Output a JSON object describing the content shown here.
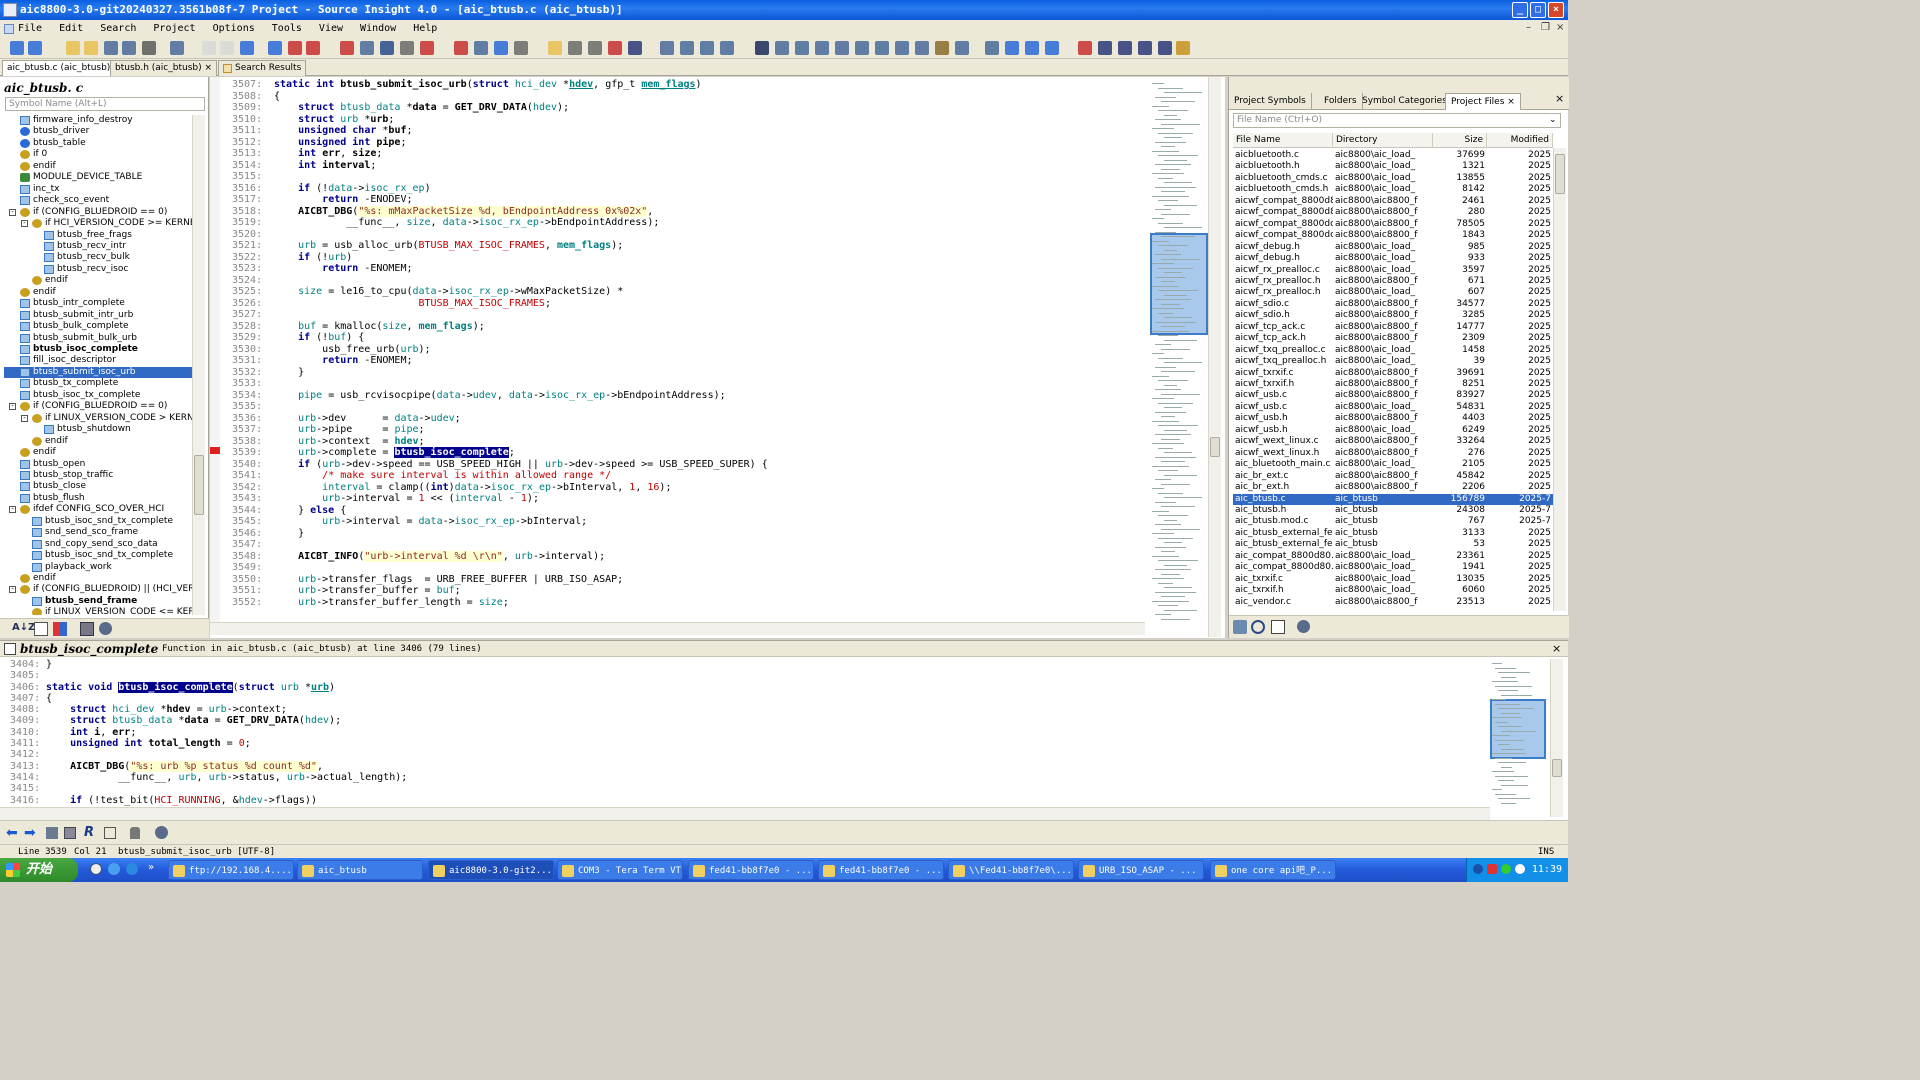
{
  "window": {
    "title": "aic8800-3.0-git20240327.3561b08f-7 Project - Source Insight 4.0 - [aic_btusb.c (aic_btusb)]"
  },
  "menu": [
    "File",
    "Edit",
    "Search",
    "Project",
    "Options",
    "Tools",
    "View",
    "Window",
    "Help"
  ],
  "tabs": [
    {
      "label": "aic_btusb.c (aic_btusb)",
      "close": "×"
    },
    {
      "label": "btusb.h (aic_btusb)",
      "close": "×"
    },
    {
      "label": "Search Results"
    }
  ],
  "symbol_panel": {
    "title": "aic_btusb. c",
    "search_placeholder": "Symbol Name (Alt+L)",
    "items": [
      {
        "label": "firmware_info_destroy",
        "icon": "doc",
        "indent": 1
      },
      {
        "label": "btusb_driver",
        "icon": "sys",
        "indent": 1
      },
      {
        "label": "btusb_table",
        "icon": "sys",
        "indent": 1
      },
      {
        "label": "if 0",
        "icon": "gear",
        "indent": 1
      },
      {
        "label": "endif",
        "icon": "gear",
        "indent": 1
      },
      {
        "label": "MODULE_DEVICE_TABLE",
        "icon": "brace",
        "indent": 1
      },
      {
        "label": "inc_tx",
        "icon": "doc",
        "indent": 1
      },
      {
        "label": "check_sco_event",
        "icon": "doc",
        "indent": 1
      },
      {
        "label": "if (CONFIG_BLUEDROID == 0)",
        "icon": "gear",
        "indent": 1,
        "toggle": "-"
      },
      {
        "label": "if HCI_VERSION_CODE >= KERNEL_",
        "icon": "gear",
        "indent": 2,
        "toggle": "-"
      },
      {
        "label": "btusb_free_frags",
        "icon": "doc",
        "indent": 3
      },
      {
        "label": "btusb_recv_intr",
        "icon": "doc",
        "indent": 3
      },
      {
        "label": "btusb_recv_bulk",
        "icon": "doc",
        "indent": 3
      },
      {
        "label": "btusb_recv_isoc",
        "icon": "doc",
        "indent": 3
      },
      {
        "label": "endif",
        "icon": "gear",
        "indent": 2
      },
      {
        "label": "endif",
        "icon": "gear",
        "indent": 1
      },
      {
        "label": "btusb_intr_complete",
        "icon": "doc",
        "indent": 1
      },
      {
        "label": "btusb_submit_intr_urb",
        "icon": "doc",
        "indent": 1
      },
      {
        "label": "btusb_bulk_complete",
        "icon": "doc",
        "indent": 1
      },
      {
        "label": "btusb_submit_bulk_urb",
        "icon": "doc",
        "indent": 1
      },
      {
        "label": "btusb_isoc_complete",
        "icon": "doc",
        "indent": 1,
        "bold": true
      },
      {
        "label": "fill_isoc_descriptor",
        "icon": "doc",
        "indent": 1
      },
      {
        "label": "btusb_submit_isoc_urb",
        "icon": "doc",
        "indent": 1,
        "selected": true
      },
      {
        "label": "btusb_tx_complete",
        "icon": "doc",
        "indent": 1
      },
      {
        "label": "btusb_isoc_tx_complete",
        "icon": "doc",
        "indent": 1
      },
      {
        "label": "if (CONFIG_BLUEDROID == 0)",
        "icon": "gear",
        "indent": 1,
        "toggle": "-"
      },
      {
        "label": "if LINUX_VERSION_CODE > KERNE",
        "icon": "gear",
        "indent": 2,
        "toggle": "-"
      },
      {
        "label": "btusb_shutdown",
        "icon": "doc",
        "indent": 3
      },
      {
        "label": "endif",
        "icon": "gear",
        "indent": 2
      },
      {
        "label": "endif",
        "icon": "gear",
        "indent": 1
      },
      {
        "label": "btusb_open",
        "icon": "doc",
        "indent": 1
      },
      {
        "label": "btusb_stop_traffic",
        "icon": "doc",
        "indent": 1
      },
      {
        "label": "btusb_close",
        "icon": "doc",
        "indent": 1
      },
      {
        "label": "btusb_flush",
        "icon": "doc",
        "indent": 1
      },
      {
        "label": "ifdef CONFIG_SCO_OVER_HCI",
        "icon": "gear",
        "indent": 1,
        "toggle": "-"
      },
      {
        "label": "btusb_isoc_snd_tx_complete",
        "icon": "doc",
        "indent": 2
      },
      {
        "label": "snd_send_sco_frame",
        "icon": "doc",
        "indent": 2
      },
      {
        "label": "snd_copy_send_sco_data",
        "icon": "doc",
        "indent": 2
      },
      {
        "label": "btusb_isoc_snd_tx_complete",
        "icon": "doc",
        "indent": 2
      },
      {
        "label": "playback_work",
        "icon": "doc",
        "indent": 2
      },
      {
        "label": "endif",
        "icon": "gear",
        "indent": 1
      },
      {
        "label": "if (CONFIG_BLUEDROID) || (HCI_VERSI",
        "icon": "gear",
        "indent": 1,
        "toggle": "-"
      },
      {
        "label": "btusb_send_frame",
        "icon": "doc",
        "indent": 2,
        "bold": true
      },
      {
        "label": "if LINUX_VERSION_CODE <= KERN",
        "icon": "gear",
        "indent": 2
      }
    ]
  },
  "editor": {
    "lines": [
      {
        "n": "3507:",
        "h": "<span class='kw'>static</span> <span class='ty'>int</span> <span class='fn'>btusb_submit_isoc_urb</span>(<span class='ty'>struct</span> <span class='id'>hci_dev</span> *<span class='id'><b><u>hdev</u></b></span>, gfp_t <span class='id'><b><u>mem_flags</u></b></span>)"
      },
      {
        "n": "3508:",
        "h": "{"
      },
      {
        "n": "3509:",
        "h": "    <span class='ty'>struct</span> <span class='id'>btusb_data</span> *<b>data</b> = <span class='fn'>GET_DRV_DATA</span>(<span class='id'>hdev</span>);"
      },
      {
        "n": "3510:",
        "h": "    <span class='ty'>struct</span> <span class='id'>urb</span> *<b>urb</b>;"
      },
      {
        "n": "3511:",
        "h": "    <span class='ty'>unsigned char</span> *<b>buf</b>;"
      },
      {
        "n": "3512:",
        "h": "    <span class='ty'>unsigned int</span> <b>pipe</b>;"
      },
      {
        "n": "3513:",
        "h": "    <span class='ty'>int</span> <b>err</b>, <b>size</b>;"
      },
      {
        "n": "3514:",
        "h": "    <span class='ty'>int</span> <b>interval</b>;"
      },
      {
        "n": "3515:",
        "h": ""
      },
      {
        "n": "3516:",
        "h": "    <span class='kw'>if</span> (!<span class='id'>data</span>-><span class='id'>isoc_rx_ep</span>)"
      },
      {
        "n": "3517:",
        "h": "        <span class='kw'>return</span> -ENODEV;"
      },
      {
        "n": "3518:",
        "h": "    <span class='fn'>AICBT_DBG</span>(<span class='str'>\"%s: mMaxPacketSize %d, bEndpointAddress 0x%02x\"</span>,"
      },
      {
        "n": "3519:",
        "h": "            __func__, <span class='id'>size</span>, <span class='id'>data</span>-><span class='id'>isoc_rx_ep</span>->bEndpointAddress);"
      },
      {
        "n": "3520:",
        "h": ""
      },
      {
        "n": "3521:",
        "h": "    <span class='id'>urb</span> = usb_alloc_urb(<span class='mac'>BTUSB_MAX_ISOC_FRAMES</span>, <span class='id'><b>mem_flags</b></span>);"
      },
      {
        "n": "3522:",
        "h": "    <span class='kw'>if</span> (!<span class='id'>urb</span>)"
      },
      {
        "n": "3523:",
        "h": "        <span class='kw'>return</span> -ENOMEM;"
      },
      {
        "n": "3524:",
        "h": ""
      },
      {
        "n": "3525:",
        "h": "    <span class='id'>size</span> = le16_to_cpu(<span class='id'>data</span>-><span class='id'>isoc_rx_ep</span>->wMaxPacketSize) *"
      },
      {
        "n": "3526:",
        "h": "                        <span class='mac'>BTUSB_MAX_ISOC_FRAMES</span>;"
      },
      {
        "n": "3527:",
        "h": ""
      },
      {
        "n": "3528:",
        "h": "    <span class='id'>buf</span> = kmalloc(<span class='id'>size</span>, <span class='id'><b>mem_flags</b></span>);"
      },
      {
        "n": "3529:",
        "h": "    <span class='kw'>if</span> (!<span class='id'>buf</span>) {"
      },
      {
        "n": "3530:",
        "h": "        usb_free_urb(<span class='id'>urb</span>);"
      },
      {
        "n": "3531:",
        "h": "        <span class='kw'>return</span> -ENOMEM;"
      },
      {
        "n": "3532:",
        "h": "    }"
      },
      {
        "n": "3533:",
        "h": ""
      },
      {
        "n": "3534:",
        "h": "    <span class='id'>pipe</span> = usb_rcvisocpipe(<span class='id'>data</span>-><span class='id'>udev</span>, <span class='id'>data</span>-><span class='id'>isoc_rx_ep</span>->bEndpointAddress);"
      },
      {
        "n": "3535:",
        "h": ""
      },
      {
        "n": "3536:",
        "h": "    <span class='id'>urb</span>->dev      = <span class='id'>data</span>-><span class='id'>udev</span>;"
      },
      {
        "n": "3537:",
        "h": "    <span class='id'>urb</span>->pipe     = <span class='id'>pipe</span>;"
      },
      {
        "n": "3538:",
        "h": "    <span class='id'>urb</span>->context  = <span class='id'><b>hdev</b></span>;"
      },
      {
        "n": "3539:",
        "h": "    <span class='id'>urb</span>->complete = <span class='hl'>btusb_isoc_complete</span>;"
      },
      {
        "n": "3540:",
        "h": "    <span class='kw'>if</span> (<span class='id'>urb</span>->dev->speed == USB_SPEED_HIGH || <span class='id'>urb</span>->dev->speed >= USB_SPEED_SUPER) {"
      },
      {
        "n": "3541:",
        "h": "        <span class='cm'>/* make sure interval is within allowed range */</span>"
      },
      {
        "n": "3542:",
        "h": "        <span class='id'>interval</span> = clamp((<span class='ty'>int</span>)<span class='id'>data</span>-><span class='id'>isoc_rx_ep</span>->bInterval, <span class='mac'>1</span>, <span class='mac'>16</span>);"
      },
      {
        "n": "3543:",
        "h": "        <span class='id'>urb</span>->interval = <span class='mac'>1</span> << (<span class='id'>interval</span> - <span class='mac'>1</span>);"
      },
      {
        "n": "3544:",
        "h": "    } <span class='kw'>else</span> {"
      },
      {
        "n": "3545:",
        "h": "        <span class='id'>urb</span>->interval = <span class='id'>data</span>-><span class='id'>isoc_rx_ep</span>->bInterval;"
      },
      {
        "n": "3546:",
        "h": "    }"
      },
      {
        "n": "3547:",
        "h": ""
      },
      {
        "n": "3548:",
        "h": "    <span class='fn'>AICBT_INFO</span>(<span class='str'>\"urb->interval %d \\r\\n\"</span>, <span class='id'>urb</span>->interval);"
      },
      {
        "n": "3549:",
        "h": ""
      },
      {
        "n": "3550:",
        "h": "    <span class='id'>urb</span>->transfer_flags  = URB_FREE_BUFFER | URB_ISO_ASAP;"
      },
      {
        "n": "3551:",
        "h": "    <span class='id'>urb</span>->transfer_buffer = <span class='id'>buf</span>;"
      },
      {
        "n": "3552:",
        "h": "    <span class='id'>urb</span>->transfer_buffer_length = <span class='id'>size</span>;"
      }
    ]
  },
  "project_panel": {
    "tabs": [
      "Project Symbols",
      "Folders",
      "Symbol Categories",
      "Project Files"
    ],
    "active_tab": "Project Files",
    "close": "×",
    "search_placeholder": "File Name (Ctrl+O)",
    "columns": [
      "File Name",
      "Directory",
      "Size",
      "Modified"
    ],
    "files": [
      [
        "aicbluetooth.c",
        "aic8800\\aic_load_",
        "37699",
        "2025"
      ],
      [
        "aicbluetooth.h",
        "aic8800\\aic_load_",
        "1321",
        "2025"
      ],
      [
        "aicbluetooth_cmds.c",
        "aic8800\\aic_load_",
        "13855",
        "2025"
      ],
      [
        "aicbluetooth_cmds.h",
        "aic8800\\aic_load_",
        "8142",
        "2025"
      ],
      [
        "aicwf_compat_8800d80.",
        "aic8800\\aic8800_f",
        "2461",
        "2025"
      ],
      [
        "aicwf_compat_8800d80.",
        "aic8800\\aic8800_f",
        "280",
        "2025"
      ],
      [
        "aicwf_compat_8800dc.c",
        "aic8800\\aic8800_f",
        "78505",
        "2025"
      ],
      [
        "aicwf_compat_8800dc.h",
        "aic8800\\aic8800_f",
        "1843",
        "2025"
      ],
      [
        "aicwf_debug.h",
        "aic8800\\aic_load_",
        "985",
        "2025"
      ],
      [
        "aicwf_debug.h",
        "aic8800\\aic_load_",
        "933",
        "2025"
      ],
      [
        "aicwf_rx_prealloc.c",
        "aic8800\\aic_load_",
        "3597",
        "2025"
      ],
      [
        "aicwf_rx_prealloc.h",
        "aic8800\\aic8800_f",
        "671",
        "2025"
      ],
      [
        "aicwf_rx_prealloc.h",
        "aic8800\\aic_load_",
        "607",
        "2025"
      ],
      [
        "aicwf_sdio.c",
        "aic8800\\aic8800_f",
        "34577",
        "2025"
      ],
      [
        "aicwf_sdio.h",
        "aic8800\\aic8800_f",
        "3285",
        "2025"
      ],
      [
        "aicwf_tcp_ack.c",
        "aic8800\\aic8800_f",
        "14777",
        "2025"
      ],
      [
        "aicwf_tcp_ack.h",
        "aic8800\\aic8800_f",
        "2309",
        "2025"
      ],
      [
        "aicwf_txq_prealloc.c",
        "aic8800\\aic_load_",
        "1458",
        "2025"
      ],
      [
        "aicwf_txq_prealloc.h",
        "aic8800\\aic_load_",
        "39",
        "2025"
      ],
      [
        "aicwf_txrxif.c",
        "aic8800\\aic8800_f",
        "39691",
        "2025"
      ],
      [
        "aicwf_txrxif.h",
        "aic8800\\aic8800_f",
        "8251",
        "2025"
      ],
      [
        "aicwf_usb.c",
        "aic8800\\aic8800_f",
        "83927",
        "2025"
      ],
      [
        "aicwf_usb.c",
        "aic8800\\aic_load_",
        "54831",
        "2025"
      ],
      [
        "aicwf_usb.h",
        "aic8800\\aic8800_f",
        "4403",
        "2025"
      ],
      [
        "aicwf_usb.h",
        "aic8800\\aic_load_",
        "6249",
        "2025"
      ],
      [
        "aicwf_wext_linux.c",
        "aic8800\\aic8800_f",
        "33264",
        "2025"
      ],
      [
        "aicwf_wext_linux.h",
        "aic8800\\aic8800_f",
        "276",
        "2025"
      ],
      [
        "aic_bluetooth_main.c",
        "aic8800\\aic_load_",
        "2105",
        "2025"
      ],
      [
        "aic_br_ext.c",
        "aic8800\\aic8800_f",
        "45842",
        "2025"
      ],
      [
        "aic_br_ext.h",
        "aic8800\\aic8800_f",
        "2206",
        "2025"
      ],
      [
        "aic_btusb.c",
        "aic_btusb",
        "156789",
        "2025-7"
      ],
      [
        "aic_btusb.h",
        "aic_btusb",
        "24308",
        "2025-7"
      ],
      [
        "aic_btusb.mod.c",
        "aic_btusb",
        "767",
        "2025-7"
      ],
      [
        "aic_btusb_external_featu",
        "aic_btusb",
        "3133",
        "2025"
      ],
      [
        "aic_btusb_external_featu",
        "aic_btusb",
        "53",
        "2025"
      ],
      [
        "aic_compat_8800d80.c",
        "aic8800\\aic_load_",
        "23361",
        "2025"
      ],
      [
        "aic_compat_8800d80.h",
        "aic8800\\aic_load_",
        "1941",
        "2025"
      ],
      [
        "aic_txrxif.c",
        "aic8800\\aic_load_",
        "13035",
        "2025"
      ],
      [
        "aic_txrxif.h",
        "aic8800\\aic_load_",
        "6060",
        "2025"
      ],
      [
        "aic_vendor.c",
        "aic8800\\aic8800_f",
        "23513",
        "2025"
      ]
    ],
    "selected_index": 30
  },
  "context": {
    "symbol": "btusb_isoc_complete",
    "info": "Function in aic_btusb.c (aic_btusb) at line 3406 (79 lines)",
    "close": "×",
    "lines": [
      {
        "n": "3404:",
        "h": "}"
      },
      {
        "n": "3405:",
        "h": ""
      },
      {
        "n": "3406:",
        "h": "<span class='kw'>static</span> <span class='ty'>void</span> <span class='hl'>btusb_isoc_complete</span>(<span class='ty'>struct</span> <span class='id'>urb</span> *<span class='id'><b><u>urb</u></b></span>)"
      },
      {
        "n": "3407:",
        "h": "{"
      },
      {
        "n": "3408:",
        "h": "    <span class='ty'>struct</span> <span class='id'>hci_dev</span> *<b>hdev</b> = <span class='id'>urb</span>->context;"
      },
      {
        "n": "3409:",
        "h": "    <span class='ty'>struct</span> <span class='id'>btusb_data</span> *<b>data</b> = <span class='fn'>GET_DRV_DATA</span>(<span class='id'>hdev</span>);"
      },
      {
        "n": "3410:",
        "h": "    <span class='ty'>int</span> <b>i</b>, <b>err</b>;"
      },
      {
        "n": "3411:",
        "h": "    <span class='ty'>unsigned int</span> <b>total_length</b> = <span class='mac'>0</span>;"
      },
      {
        "n": "3412:",
        "h": ""
      },
      {
        "n": "3413:",
        "h": "    <span class='fn'>AICBT_DBG</span>(<span class='str'>\"%s: urb %p status %d count %d\"</span>,"
      },
      {
        "n": "3414:",
        "h": "            __func__, <span class='id'>urb</span>, <span class='id'>urb</span>->status, <span class='id'>urb</span>->actual_length);"
      },
      {
        "n": "3415:",
        "h": ""
      },
      {
        "n": "3416:",
        "h": "    <span class='kw'>if</span> (!test_bit(<span class='mac'>HCI_RUNNING</span>, &amp;<span class='id'>hdev</span>->flags))"
      }
    ]
  },
  "status": {
    "line": "Line 3539",
    "col": "Col 21",
    "symbol": "btusb_submit_isoc_urb [UTF-8]",
    "mode": "INS"
  },
  "taskbar": {
    "start": "开始",
    "tasks": [
      "ftp://192.168.4....",
      "aic_btusb",
      "aic8800-3.0-git2...",
      "COM3 - Tera Term VT",
      "fed41-bb8f7e0 - ...",
      "fed41-bb8f7e0 - ...",
      "\\\\Fed41-bb8f7e0\\...",
      "URB_ISO_ASAP - ...",
      "one core api吧_P..."
    ],
    "active_task": 2,
    "clock": "11:39"
  }
}
